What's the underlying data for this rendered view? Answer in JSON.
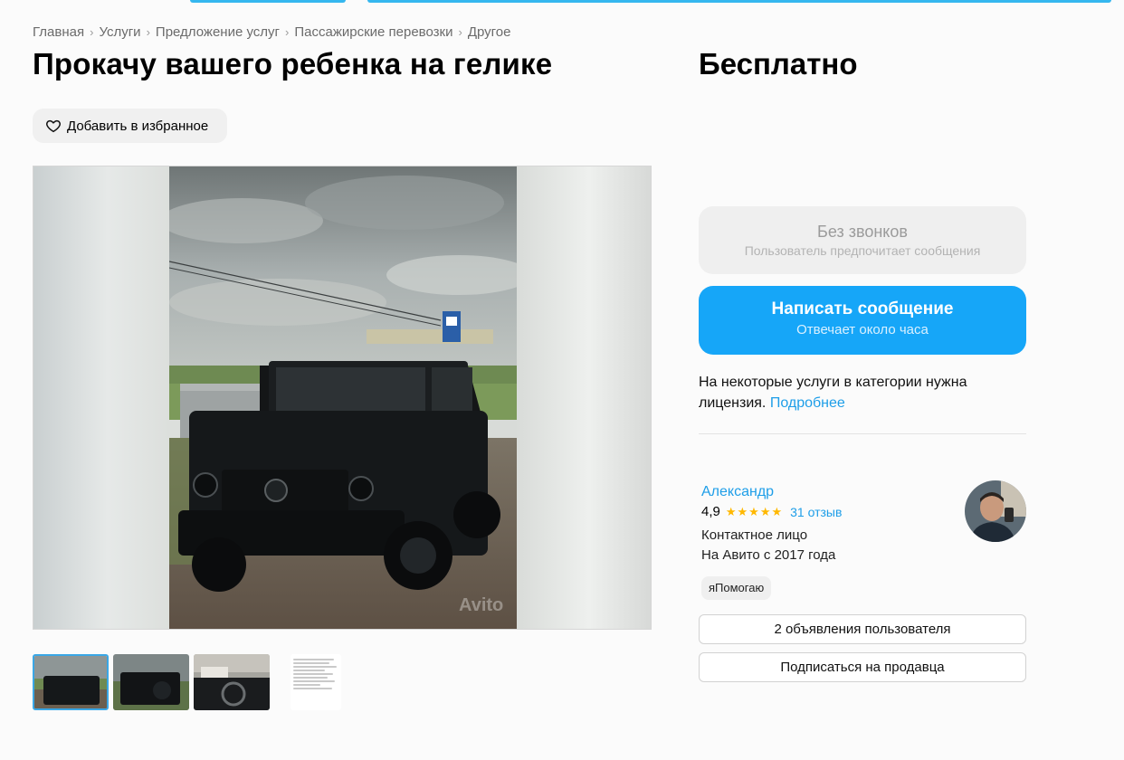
{
  "breadcrumb": [
    "Главная",
    "Услуги",
    "Предложение услуг",
    "Пассажирские перевозки",
    "Другое"
  ],
  "listing": {
    "title": "Прокачу вашего ребенка на гелике",
    "price": "Бесплатно",
    "favorite_label": "Добавить в избранное",
    "watermark": "Avito"
  },
  "contact_panel": {
    "no_calls_title": "Без звонков",
    "no_calls_subtitle": "Пользователь предпочитает сообщения",
    "message_button": "Написать сообщение",
    "message_subtitle": "Отвечает около часа",
    "license_text": "На некоторые услуги в категории нужна лицензия.",
    "license_link": "Подробнее"
  },
  "seller": {
    "name": "Александр",
    "rating": "4,9",
    "stars": 5,
    "reviews": "31 отзыв",
    "role": "Контактное лицо",
    "since": "На Авито с 2017 года",
    "badge": "яПомогаю",
    "ads_button": "2 объявления пользователя",
    "subscribe_button": "Подписаться на продавца"
  },
  "colors": {
    "accent": "#16a6f8",
    "link": "#1e9ee8",
    "star": "#ffb800"
  }
}
